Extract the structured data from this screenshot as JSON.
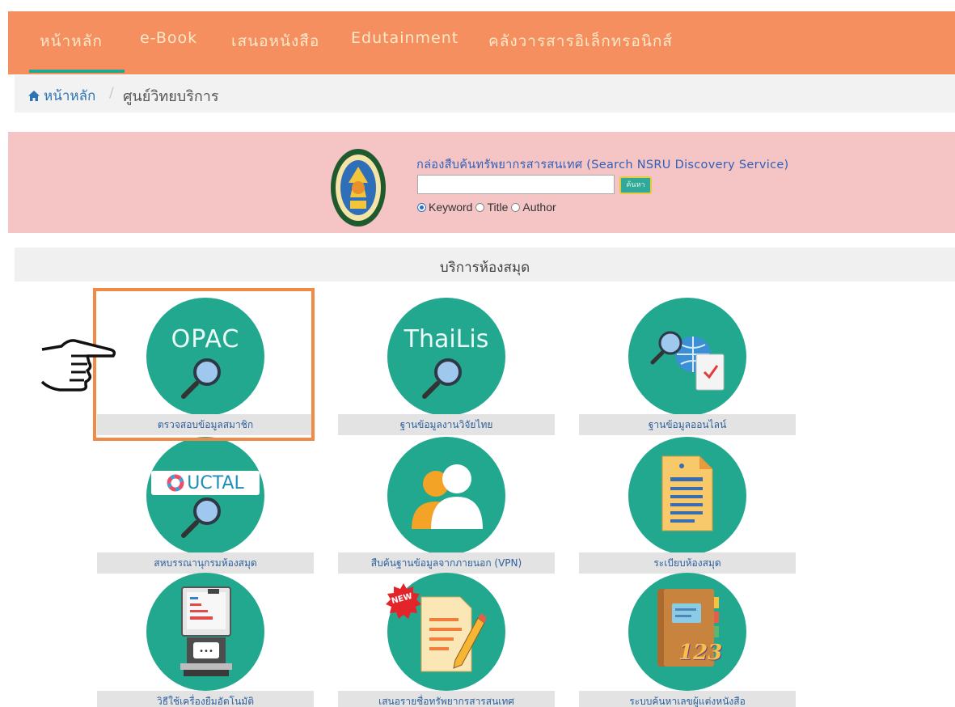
{
  "nav": {
    "items": [
      "หน้าหลัก",
      "e-Book",
      "เสนอหนังสือ",
      "Edutainment",
      "คลังวารสารอิเล็กทรอนิกส์"
    ]
  },
  "breadcrumb": {
    "home": "หน้าหลัก",
    "separator": "/",
    "current": "ศูนย์วิทยบริการ"
  },
  "search": {
    "title": "กล่องสืบค้นทรัพยากรสารสนเทศ (Search NSRU Discovery Service)",
    "input_value": "",
    "button_label": "ค้นหา",
    "options": [
      "Keyword",
      "Title",
      "Author"
    ],
    "selected": "Keyword"
  },
  "section": {
    "title": "บริการห้องสมุด"
  },
  "tiles": [
    {
      "label": "ตรวจสอบข้อมูลสมาชิก",
      "circle_text": "OPAC",
      "icon": "magnifier-icon"
    },
    {
      "label": "ฐานข้อมูลงานวิจัยไทย",
      "circle_text": "ThaiLis",
      "icon": "magnifier-icon"
    },
    {
      "label": "ฐานข้อมูลออนไลน์",
      "icon": "globe-search-icon"
    },
    {
      "label": "สหบรรณานุกรมห้องสมุด",
      "circle_text": "UCTAL",
      "icon": "magnifier-icon"
    },
    {
      "label": "สืบค้นฐานข้อมูลจากภายนอก (VPN)",
      "icon": "users-icon"
    },
    {
      "label": "ระเบียบห้องสมุด",
      "icon": "document-icon"
    },
    {
      "label": "วิธีใช้เครื่องยืมอัตโนมัติ",
      "icon": "kiosk-icon"
    },
    {
      "label": "เสนอรายชื่อทรัพยากรสารสนเทศ",
      "badge": "NEW",
      "icon": "edit-document-icon"
    },
    {
      "label": "ระบบค้นหาเลขผู้แต่งหนังสือ",
      "badge_numbers": "123",
      "icon": "notebook-icon"
    }
  ],
  "colors": {
    "nav_bg": "#f58f5f",
    "accent_green": "#22a88f",
    "banner_bg": "#f5c4c4",
    "highlight": "#f08a46",
    "link_blue": "#2c74b4"
  }
}
